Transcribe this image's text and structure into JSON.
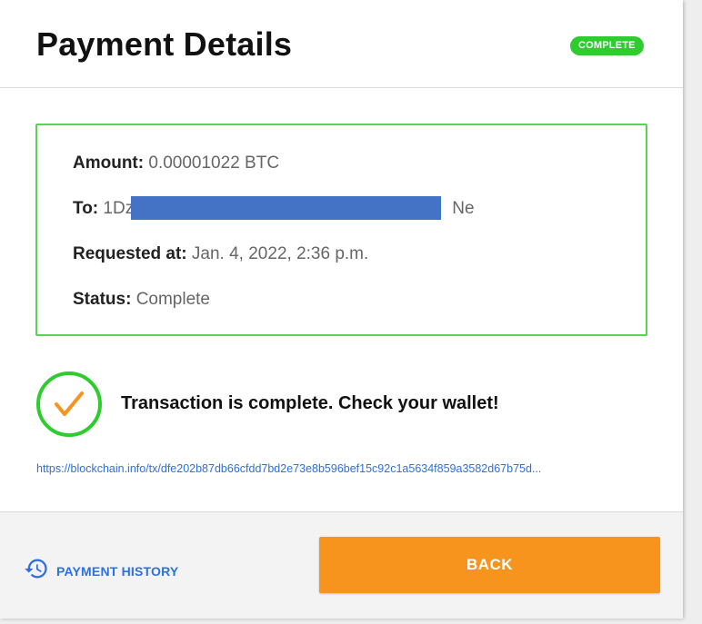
{
  "header": {
    "title": "Payment Details",
    "status_badge": "COMPLETE"
  },
  "details": {
    "amount_label": "Amount:",
    "amount_value": "0.00001022 BTC",
    "to_label": "To:",
    "to_value_start": "1Dz",
    "to_value_end": "Ne",
    "requested_label": "Requested at:",
    "requested_value": "Jan. 4, 2022, 2:36 p.m.",
    "status_label": "Status:",
    "status_value": "Complete"
  },
  "confirmation": {
    "message": "Transaction is complete. Check your wallet!",
    "tx_link": "https://blockchain.info/tx/dfe202b87db66cfdd7bd2e73e8b596bef15c92c1a5634f859a3582d67b75d..."
  },
  "footer": {
    "history_label": "PAYMENT HISTORY",
    "back_label": "BACK"
  },
  "colors": {
    "accent_green": "#2ecc2e",
    "button_orange": "#f7941d",
    "link_blue": "#2f6fde",
    "redaction_blue": "#4472c4"
  },
  "icons": [
    "check-icon",
    "history-icon"
  ]
}
